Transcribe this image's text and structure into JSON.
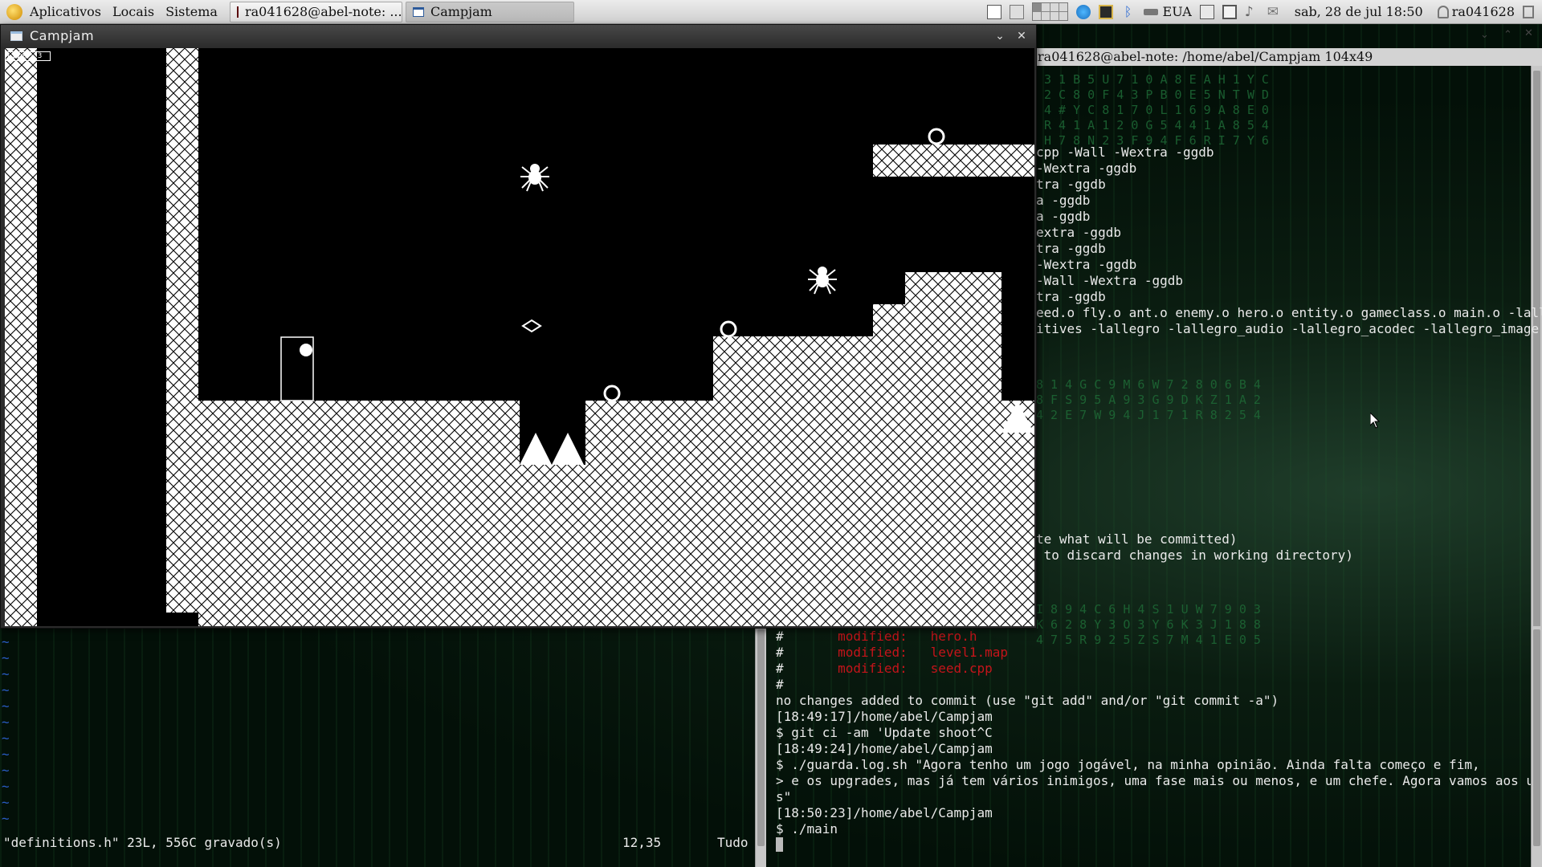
{
  "top_panel": {
    "menus": [
      "Aplicativos",
      "Locais",
      "Sistema"
    ],
    "tasks": [
      {
        "label": "ra041628@abel-note: ...",
        "active": false
      },
      {
        "label": "Campjam",
        "active": true
      }
    ],
    "keyboard_layout": "EUA",
    "datetime": "sab, 28 de jul 18:50",
    "user": "ra041628"
  },
  "game_window": {
    "title": "Campjam",
    "hud_lives": "Lives: 3"
  },
  "terminal_right": {
    "title": "ra041628@abel-note: /home/abel/Campjam 104x49",
    "lines": [
      "cpp -Wall -Wextra -ggdb",
      "-Wextra -ggdb",
      "tra -ggdb",
      "a -ggdb",
      "a -ggdb",
      "extra -ggdb",
      "tra -ggdb",
      "-Wextra -ggdb",
      "-Wall -Wextra -ggdb",
      "tra -ggdb",
      "eed.o fly.o ant.o enemy.o hero.o entity.o gameclass.o main.o -lalleg",
      "itives -lallegro -lallegro_audio -lallegro_acodec -lallegro_image -W"
    ],
    "git_hint_lines": [
      "te what will be committed)",
      " to discard changes in working directory)"
    ]
  },
  "terminal_bottom": {
    "modified": [
      {
        "prefix": "#",
        "label": "modified:",
        "file": "hero.h"
      },
      {
        "prefix": "#",
        "label": "modified:",
        "file": "level1.map"
      },
      {
        "prefix": "#",
        "label": "modified:",
        "file": "seed.cpp"
      }
    ],
    "lines": [
      "#",
      "no changes added to commit (use \"git add\" and/or \"git commit -a\")",
      "[18:49:17]/home/abel/Campjam",
      "$ git ci -am 'Update shoot^C",
      "[18:49:24]/home/abel/Campjam",
      "$ ./guarda.log.sh \"Agora tenho um jogo jogável, na minha opinião. Ainda falta começo e fim,",
      "> e os upgrades, mas já tem vários inimigos, uma fase mais ou menos, e um chefe. Agora vamos aos upgrade",
      "s\"",
      "[18:50:23]/home/abel/Campjam",
      "$ ./main"
    ]
  },
  "vim_pane": {
    "status_file": "\"definitions.h\" 23L, 556C gravado(s)",
    "status_pos": "12,35",
    "status_all": "Tudo",
    "tilde": "~"
  },
  "colors": {
    "git_modified": "#c4141a",
    "vim_tilde": "#2a5dc6",
    "terminal_text": "#eaeaea"
  },
  "icons": [
    "distro-logo-icon",
    "terminal-icon",
    "window-icon",
    "workspace-switcher-icon",
    "network-icon",
    "bluetooth-icon",
    "volume-icon",
    "mail-icon",
    "user-icon",
    "spider-icon",
    "spike-icon",
    "ring-icon",
    "door-icon"
  ]
}
